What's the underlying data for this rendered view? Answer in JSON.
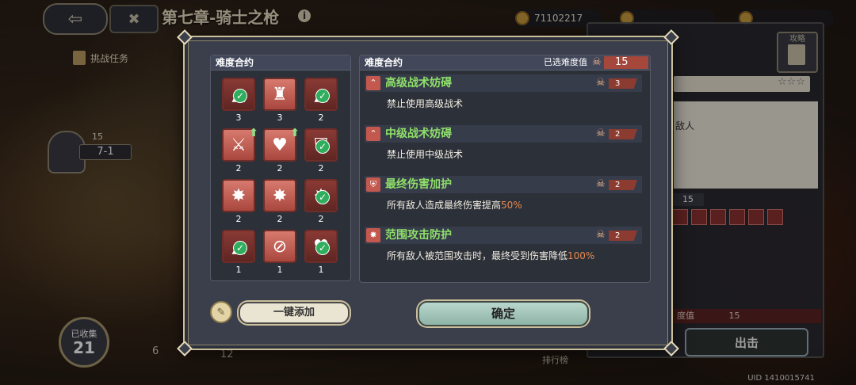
{
  "hud": {
    "chapter_title": "第七章-骑士之枪",
    "info_symbol": "i",
    "back_symbol": "⇦",
    "menu_symbol": "✖",
    "currency_1": "71102217",
    "currency_2": "",
    "currency_3": "",
    "quest_label": "挑战任务",
    "stage_level": "15",
    "stage_name": "7-1",
    "collected_label": "已收集",
    "collected_count": "21",
    "map_numbers": [
      "6",
      "12"
    ],
    "rank_label": "排行榜",
    "uid": "UID 1410015741"
  },
  "side_panel": {
    "strategy_label": "攻略",
    "stars": "☆☆☆",
    "enemy_text": "敌人",
    "level": "15",
    "difficulty_text": "度值",
    "difficulty_value": "15",
    "go_button": "出击"
  },
  "dialog": {
    "left_header": "难度合约",
    "right_header": "难度合约",
    "selected_label": "已选难度值",
    "selected_total": "15",
    "skull_icon": "☠",
    "grid": [
      {
        "icon": "up-arrow-icon",
        "count": "3",
        "checked": true,
        "dark": true
      },
      {
        "icon": "wizard-icon",
        "count": "3",
        "checked": false,
        "dark": false
      },
      {
        "icon": "up-arrow-icon",
        "count": "2",
        "checked": true,
        "dark": true
      },
      {
        "icon": "broken-sword-icon",
        "count": "2",
        "checked": false,
        "dark": false,
        "upgrade": true
      },
      {
        "icon": "heart-plus-icon",
        "count": "2",
        "checked": false,
        "dark": false,
        "upgrade": true
      },
      {
        "icon": "shield-icon",
        "count": "2",
        "checked": true,
        "dark": true
      },
      {
        "icon": "burst-icon",
        "count": "2",
        "checked": false,
        "dark": false
      },
      {
        "icon": "burst-icon",
        "count": "2",
        "checked": false,
        "dark": false
      },
      {
        "icon": "burst-icon",
        "count": "2",
        "checked": true,
        "dark": true
      },
      {
        "icon": "up-arrow-icon",
        "count": "1",
        "checked": true,
        "dark": true
      },
      {
        "icon": "no-heal-icon",
        "count": "1",
        "checked": false,
        "dark": false
      },
      {
        "icon": "heart-icon",
        "count": "1",
        "checked": true,
        "dark": true
      }
    ],
    "contracts": [
      {
        "name": "高级战术妨碍",
        "cost": "3",
        "desc": "禁止使用高级战术",
        "desc_hl": "",
        "icon": "double-chevron-icon"
      },
      {
        "name": "中级战术妨碍",
        "cost": "2",
        "desc": "禁止使用中级战术",
        "desc_hl": "",
        "icon": "double-chevron-icon"
      },
      {
        "name": "最终伤害加护",
        "cost": "2",
        "desc": "所有敌人造成最终伤害提高",
        "desc_hl": "50%",
        "icon": "shield-icon"
      },
      {
        "name": "范围攻击防护",
        "cost": "2",
        "desc": "所有敌人被范围攻击时，最终受到伤害降低",
        "desc_hl": "100%",
        "icon": "burst-icon"
      }
    ],
    "book_symbol": "✎",
    "quick_add": "一键添加",
    "confirm": "确定",
    "check_symbol": "✓",
    "upgrade_symbol": "⬆"
  }
}
